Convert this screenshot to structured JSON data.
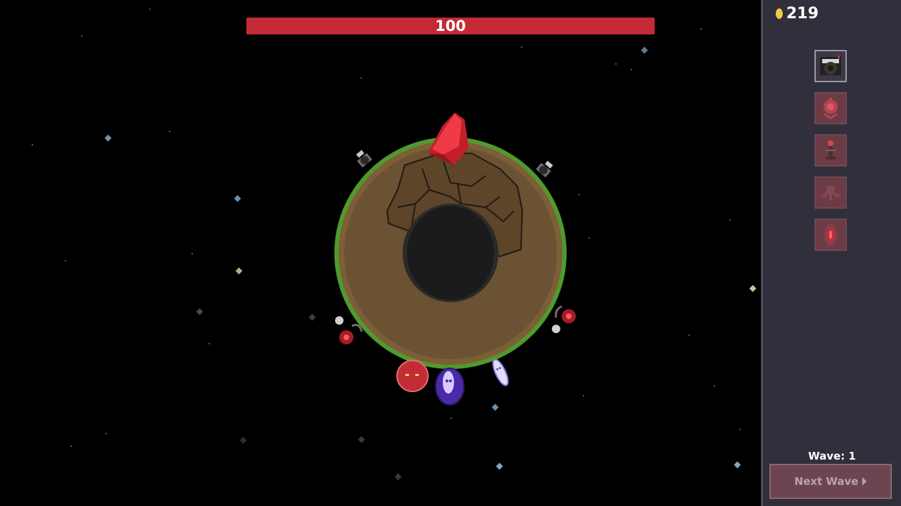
{
  "hud": {
    "core_health": 100,
    "core_health_max": 100,
    "core_health_label": "100",
    "health_color": "#c42a36"
  },
  "panel": {
    "gold_icon": "coin-icon",
    "gold_value": "219",
    "towers": [
      {
        "id": "cannon-turret",
        "icon": "cannon-turret-icon",
        "selected": true
      },
      {
        "id": "flower-turret",
        "icon": "flower-turret-icon",
        "selected": false
      },
      {
        "id": "beacon-tower",
        "icon": "beacon-tower-icon",
        "selected": false
      },
      {
        "id": "wing-turret",
        "icon": "wing-turret-icon",
        "selected": false
      },
      {
        "id": "crystal-tower",
        "icon": "crystal-tower-icon",
        "selected": false
      }
    ],
    "wave_label": "Wave: 1",
    "next_wave_label": "Next Wave"
  },
  "colors": {
    "panel_bg": "#312f3b",
    "planet_dirt": "#6b5232",
    "planet_grass": "#4f9a2e",
    "crystal": "#e0313a"
  }
}
